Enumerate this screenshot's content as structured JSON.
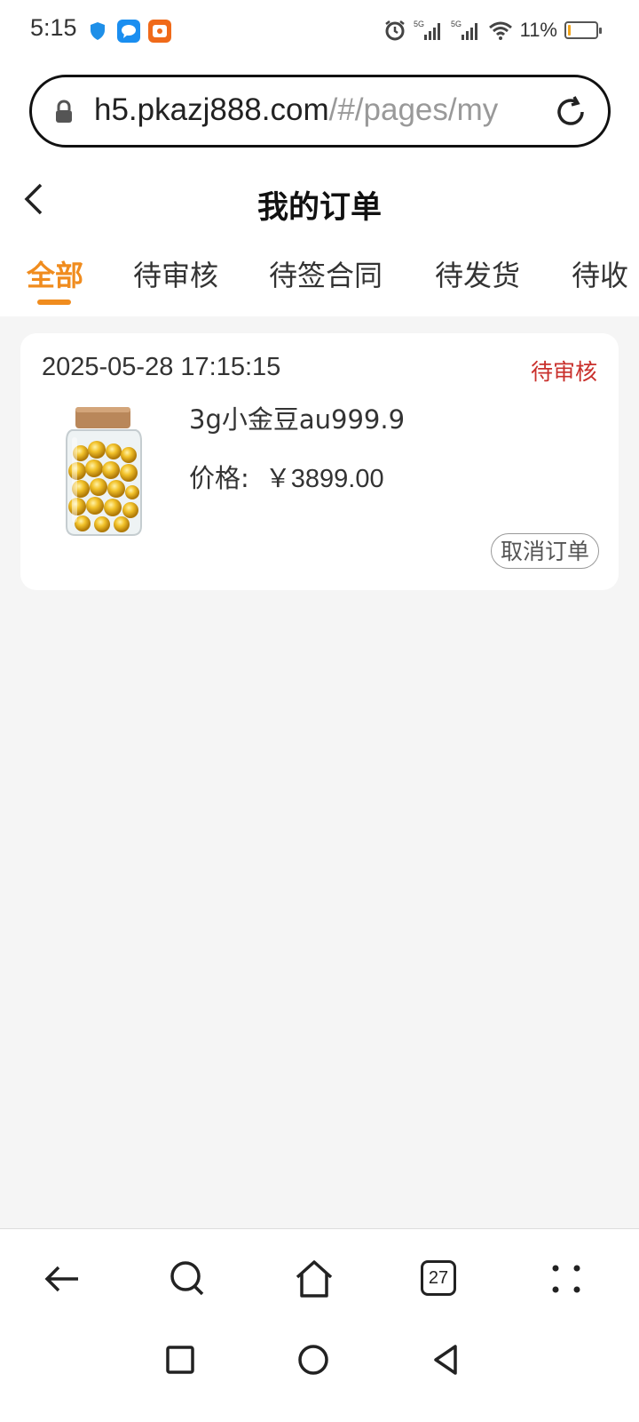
{
  "status_bar": {
    "time": "5:15",
    "battery_percent": "11%",
    "battery_level": 0.11
  },
  "browser": {
    "url_host": "h5.pkazj888.com",
    "url_path": "/#/pages/my",
    "tab_count": "27"
  },
  "header": {
    "title": "我的订单"
  },
  "tabs": [
    {
      "label": "全部",
      "active": true
    },
    {
      "label": "待审核",
      "active": false
    },
    {
      "label": "待签合同",
      "active": false
    },
    {
      "label": "待发货",
      "active": false
    },
    {
      "label": "待收",
      "active": false
    }
  ],
  "orders": [
    {
      "time": "2025-05-28 17:15:15",
      "status": "待审核",
      "product_name": "3g小金豆au999.9",
      "price_label": "价格:",
      "price_value": "￥3899.00",
      "cancel_label": "取消订单"
    }
  ],
  "colors": {
    "accent": "#f08c1e",
    "status_red": "#c9302c",
    "background": "#f5f5f5"
  },
  "icons": {
    "lock": "lock-icon",
    "reload": "reload-icon",
    "back": "chevron-left-icon",
    "nav_back": "arrow-left-icon",
    "search": "search-icon",
    "home": "home-icon",
    "menu": "more-dots-icon"
  }
}
